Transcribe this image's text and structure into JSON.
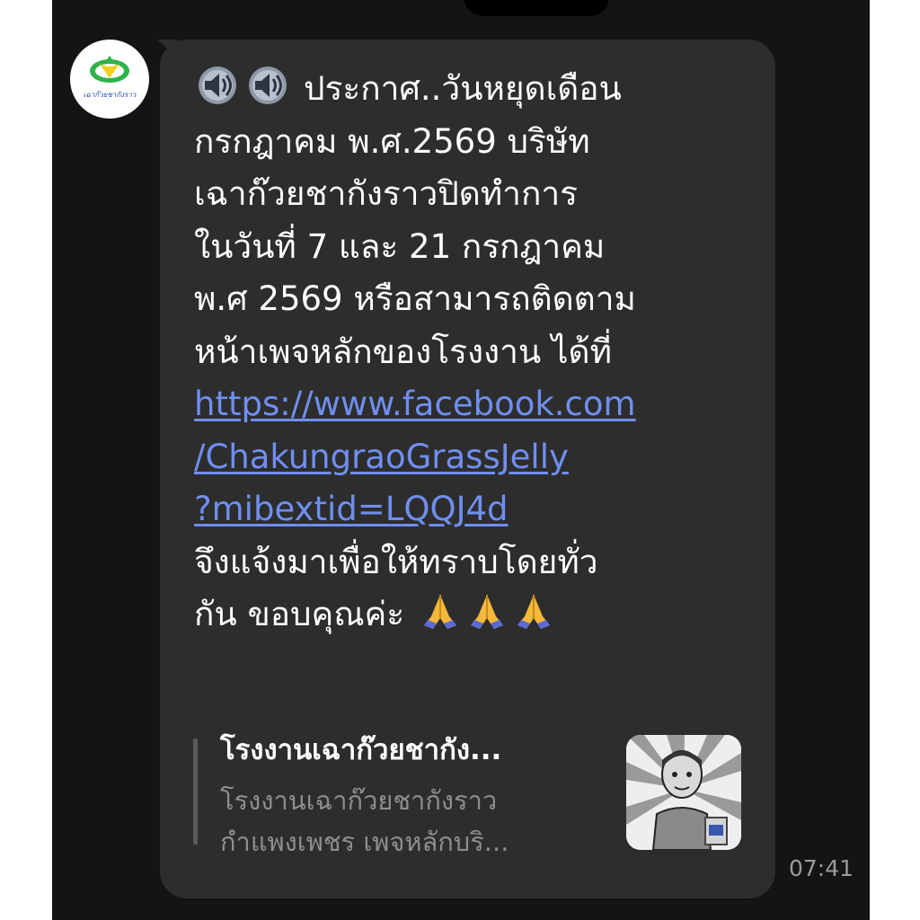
{
  "chat": {
    "sender": {
      "avatar_text": "เฉาก๊วยชากังราว"
    },
    "message": {
      "lines": [
        "ประกาศ..วันหยุดเดือน",
        "กรกฎาคม พ.ศ.2569 บริษัท",
        "เฉาก๊วยชากังราวปิดทำการ",
        "ในวันที่ 7 และ 21 กรกฎาคม",
        "พ.ศ 2569 หรือสามารถติดตาม",
        "หน้าเพจหลักของโรงงาน ได้ที่"
      ],
      "link_lines": [
        "https://www.facebook.com",
        "/ChakungraoGrassJelly",
        "?mibextid=LQQJ4d"
      ],
      "closing_lines": [
        "จึงแจ้งมาเพื่อให้ทราบโดยทั่ว",
        "กัน ขอบคุณค่ะ"
      ],
      "leading_icons": [
        "speaker-icon",
        "speaker-icon"
      ],
      "trailing_icons": [
        "pray-icon",
        "pray-icon",
        "pray-icon"
      ]
    },
    "link_preview": {
      "title": "โรงงานเฉาก๊วยชากัง...",
      "description_lines": [
        "โรงงานเฉาก๊วยชากังราว",
        "กำแพงเพชร เพจหลักบริ..."
      ]
    },
    "timestamp": "07:41"
  },
  "colors": {
    "background": "#141414",
    "bubble": "#2d2d2d",
    "text": "#ffffff",
    "link": "#6f8ff0",
    "muted": "#8e8e8e"
  }
}
